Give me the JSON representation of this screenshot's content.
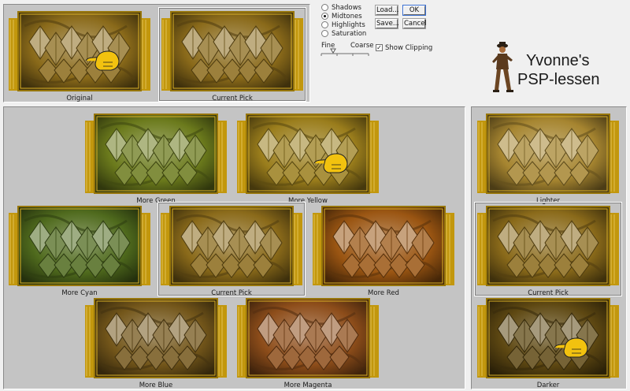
{
  "top": {
    "original_caption": "Original",
    "current_pick_caption": "Current Pick"
  },
  "tonal_range": {
    "options": [
      {
        "label": "Shadows",
        "selected": false
      },
      {
        "label": "Midtones",
        "selected": true
      },
      {
        "label": "Highlights",
        "selected": false
      },
      {
        "label": "Saturation",
        "selected": false
      }
    ]
  },
  "buttons": {
    "load": "Load...",
    "save": "Save...",
    "ok": "OK",
    "cancel": "Cancel"
  },
  "slider": {
    "fine_label": "Fine",
    "coarse_label": "Coarse",
    "value": 0.25
  },
  "show_clipping": {
    "label": "Show Clipping",
    "checked": true,
    "check_mark": "✓"
  },
  "logo": {
    "line1": "Yvonne's",
    "line2": "PSP-lessen"
  },
  "color_grid": {
    "more_green": "More Green",
    "more_yellow": "More Yellow",
    "more_cyan": "More Cyan",
    "current_pick": "Current Pick",
    "more_red": "More Red",
    "more_blue": "More Blue",
    "more_magenta": "More Magenta"
  },
  "lightness": {
    "lighter": "Lighter",
    "current_pick": "Current Pick",
    "darker": "Darker"
  },
  "colors": {
    "panel_bg": "#c4c4c4",
    "window_bg": "#f0f0f0",
    "hand": "#f2c20f",
    "frame_gold": "#d7a80e",
    "tone_original": "#8a6a1a",
    "tone_green": "#6b7a1c",
    "tone_yellow": "#9a7d1c",
    "tone_cyan": "#4f6a1d",
    "tone_red": "#9a5512",
    "tone_blue": "#73561a",
    "tone_magenta": "#8d4d1a",
    "tone_lighter": "#a68530",
    "tone_darker": "#5e4812"
  }
}
